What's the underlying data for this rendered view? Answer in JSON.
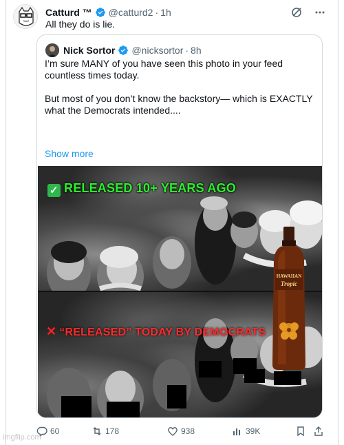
{
  "author": {
    "name": "Catturd ™",
    "handle": "@catturd2",
    "separator": "·",
    "time": "1h",
    "text": "All they do is lie."
  },
  "quoted": {
    "name": "Nick Sortor",
    "handle": "@nicksortor",
    "separator": "·",
    "time": "8h",
    "paragraph1": "I’m sure MANY of you have seen this photo in your feed countless times today.",
    "paragraph2": "But most of you don’t know the backstory— which is EXACTLY what the Democrats intended....",
    "show_more": "Show more"
  },
  "media": {
    "top_caption": "RELEASED 10+ YEARS AGO",
    "bottom_caption": "“RELEASED” TODAY BY DEMOCRATS",
    "bottle_brand": "HAWAIIAN Tropic"
  },
  "stats": {
    "replies": "60",
    "reposts": "178",
    "likes": "938",
    "views": "39K"
  },
  "watermark": "imgflip.com",
  "colors": {
    "verified": "#1d9bf0",
    "link": "#1d9bf0",
    "muted": "#536471",
    "released_green": "#2bf02b",
    "democrats_red": "#ff2b2b"
  },
  "icons": [
    "grok-icon",
    "more-icon",
    "reply-icon",
    "repost-icon",
    "like-icon",
    "views-icon",
    "bookmark-icon",
    "share-icon",
    "verified-badge-icon",
    "check-emoji-icon",
    "cross-emoji-icon"
  ]
}
